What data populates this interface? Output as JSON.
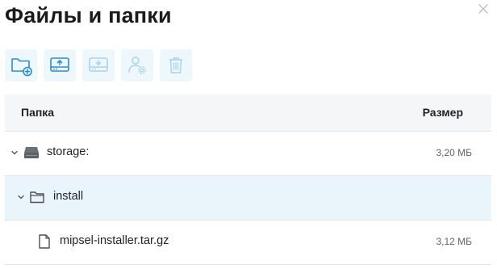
{
  "dialog": {
    "title": "Файлы и папки"
  },
  "toolbar": {
    "buttons": [
      {
        "icon": "new-folder-icon",
        "enabled": true
      },
      {
        "icon": "upload-icon",
        "enabled": true
      },
      {
        "icon": "download-icon",
        "enabled": false
      },
      {
        "icon": "user-permissions-icon",
        "enabled": false
      },
      {
        "icon": "trash-icon",
        "enabled": false
      }
    ]
  },
  "table": {
    "headers": {
      "name": "Папка",
      "size": "Размер"
    },
    "rows": [
      {
        "name": "storage:",
        "size": "3,20 МБ",
        "type": "drive",
        "expanded": true,
        "selected": false
      },
      {
        "name": "install",
        "size": "",
        "type": "folder",
        "expanded": true,
        "selected": true
      },
      {
        "name": "mipsel-installer.tar.gz",
        "size": "3,12 МБ",
        "type": "file",
        "selected": false
      }
    ]
  },
  "colors": {
    "accent": "#2a8cd2",
    "accent_disabled": "#a9d3ee",
    "toolbar_button_bg": "#eef7fc",
    "selected_row_bg": "#eaf4fb",
    "header_bg": "#f5f6f7"
  }
}
